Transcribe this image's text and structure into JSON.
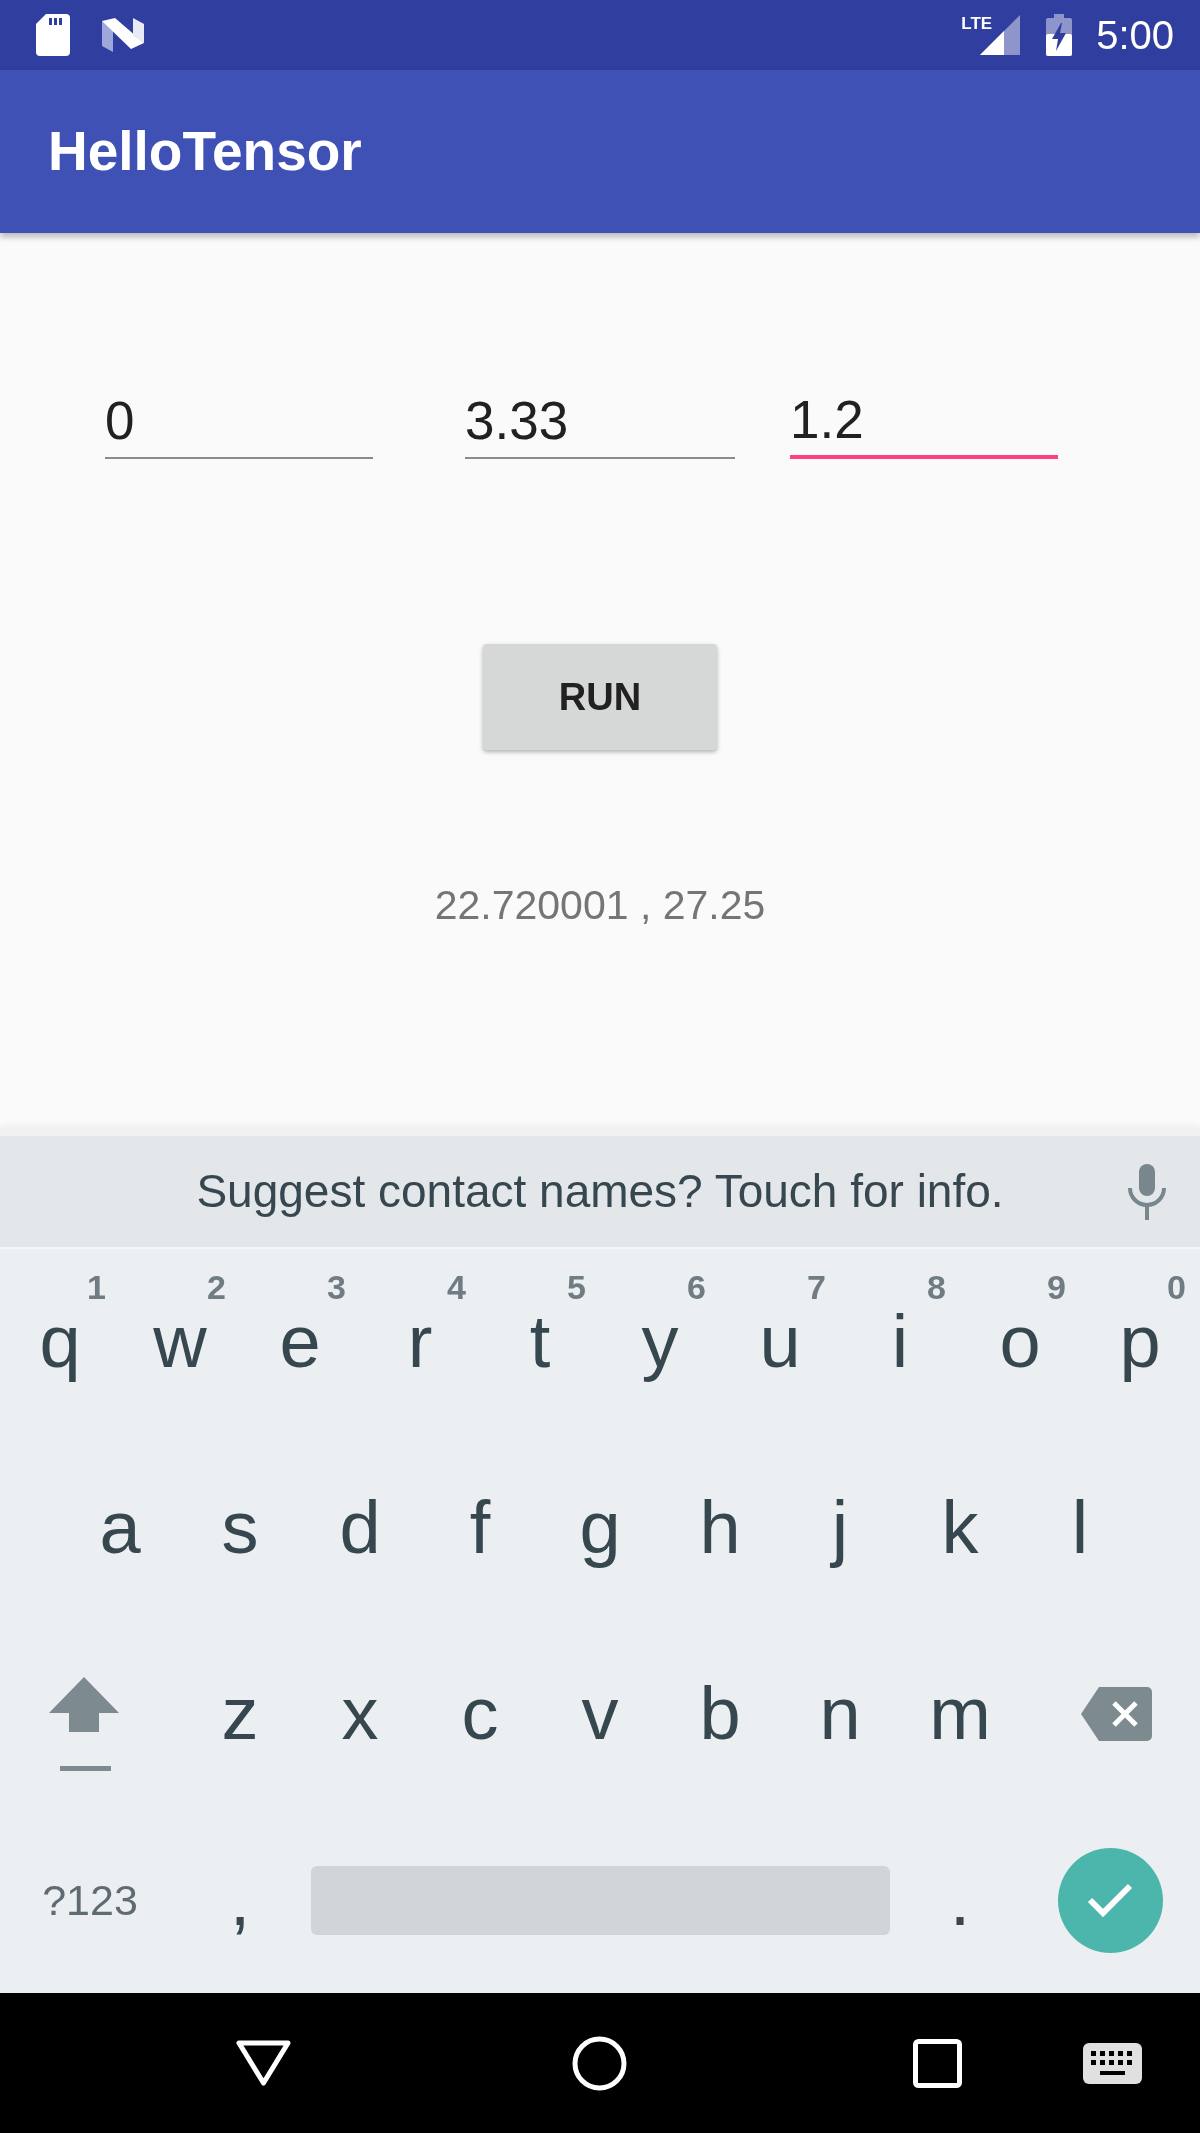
{
  "status_bar": {
    "network_type": "LTE",
    "time": "5:00"
  },
  "app_bar": {
    "title": "HelloTensor"
  },
  "fields": [
    {
      "value": "0",
      "focused": false
    },
    {
      "value": "3.33",
      "focused": false
    },
    {
      "value": "1.2",
      "focused": true
    }
  ],
  "run_button": {
    "label": "RUN"
  },
  "result": {
    "text": "22.720001 , 27.25"
  },
  "keyboard": {
    "suggestion": "Suggest contact names? Touch for info.",
    "rows": [
      {
        "keys": [
          {
            "kind": "letter",
            "label": "q",
            "hint": "1"
          },
          {
            "kind": "letter",
            "label": "w",
            "hint": "2"
          },
          {
            "kind": "letter",
            "label": "e",
            "hint": "3"
          },
          {
            "kind": "letter",
            "label": "r",
            "hint": "4"
          },
          {
            "kind": "letter",
            "label": "t",
            "hint": "5"
          },
          {
            "kind": "letter",
            "label": "y",
            "hint": "6"
          },
          {
            "kind": "letter",
            "label": "u",
            "hint": "7"
          },
          {
            "kind": "letter",
            "label": "i",
            "hint": "8"
          },
          {
            "kind": "letter",
            "label": "o",
            "hint": "9"
          },
          {
            "kind": "letter",
            "label": "p",
            "hint": "0"
          }
        ]
      },
      {
        "keys": [
          {
            "kind": "letter",
            "label": "a"
          },
          {
            "kind": "letter",
            "label": "s"
          },
          {
            "kind": "letter",
            "label": "d"
          },
          {
            "kind": "letter",
            "label": "f"
          },
          {
            "kind": "letter",
            "label": "g"
          },
          {
            "kind": "letter",
            "label": "h"
          },
          {
            "kind": "letter",
            "label": "j"
          },
          {
            "kind": "letter",
            "label": "k"
          },
          {
            "kind": "letter",
            "label": "l"
          }
        ]
      },
      {
        "keys": [
          {
            "kind": "shift"
          },
          {
            "kind": "letter",
            "label": "z"
          },
          {
            "kind": "letter",
            "label": "x"
          },
          {
            "kind": "letter",
            "label": "c"
          },
          {
            "kind": "letter",
            "label": "v"
          },
          {
            "kind": "letter",
            "label": "b"
          },
          {
            "kind": "letter",
            "label": "n"
          },
          {
            "kind": "letter",
            "label": "m"
          },
          {
            "kind": "backspace"
          }
        ]
      },
      {
        "keys": [
          {
            "kind": "symbols",
            "label": "?123"
          },
          {
            "kind": "punct",
            "label": ","
          },
          {
            "kind": "space"
          },
          {
            "kind": "punct",
            "label": "."
          },
          {
            "kind": "enter"
          }
        ]
      }
    ]
  }
}
